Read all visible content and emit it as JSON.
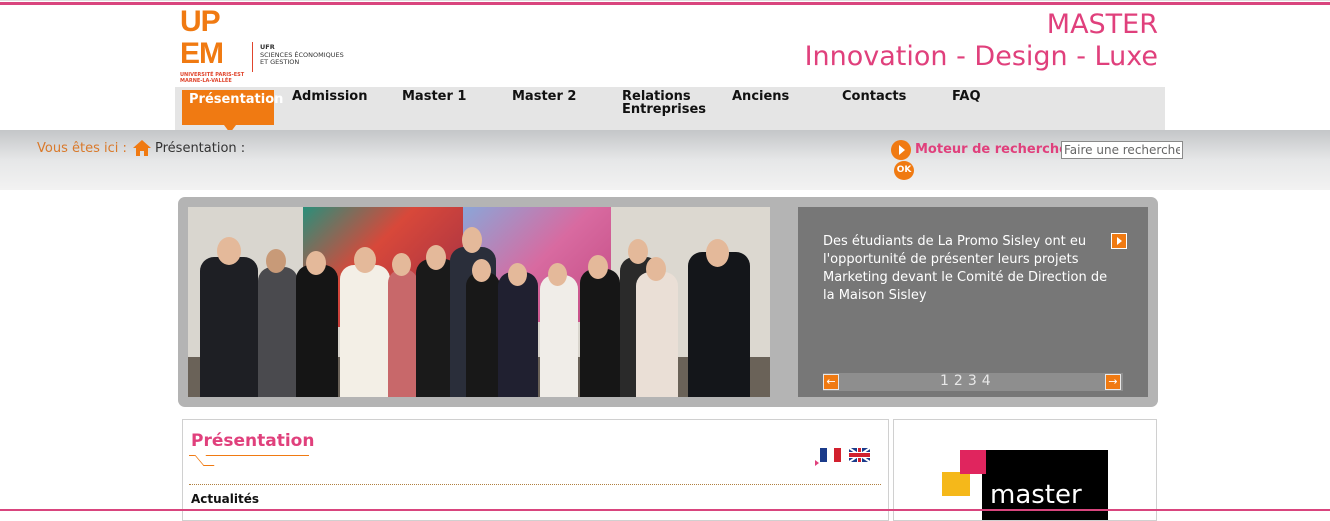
{
  "logo": {
    "upem_line1": "UP",
    "upem_line2": "EM",
    "university": "UNIVERSITÉ PARIS-EST MARNE-LA-VALLÉE",
    "ufr_line1": "UFR",
    "ufr_line2": "SCIENCES ÉCONOMIQUES",
    "ufr_line3": "ET GESTION"
  },
  "header": {
    "line1": "MASTER",
    "line2": "Innovation - Design - Luxe"
  },
  "nav": {
    "items": [
      {
        "label": "Présentation",
        "active": true
      },
      {
        "label": "Admission"
      },
      {
        "label": "Master 1"
      },
      {
        "label": "Master 2"
      },
      {
        "label": "Relations Entreprises"
      },
      {
        "label": "Anciens"
      },
      {
        "label": "Contacts"
      },
      {
        "label": "FAQ"
      }
    ]
  },
  "breadcrumb": {
    "label": "Vous êtes ici :",
    "current": "Présentation :"
  },
  "search": {
    "label": "Moteur de recherche",
    "placeholder": "Faire une recherche",
    "ok_label": "OK"
  },
  "slider": {
    "caption": "Des étudiants de La Promo Sisley ont eu l'opportunité de présenter leurs projets Marketing devant le Comité de Direction de la Maison Sisley",
    "pages": [
      "1",
      "2",
      "3",
      "4"
    ]
  },
  "content": {
    "title": "Présentation",
    "section": "Actualités"
  },
  "sidebar": {
    "logo_text": "master"
  },
  "colors": {
    "accent_orange": "#f07a12",
    "accent_pink": "#e0407c"
  }
}
